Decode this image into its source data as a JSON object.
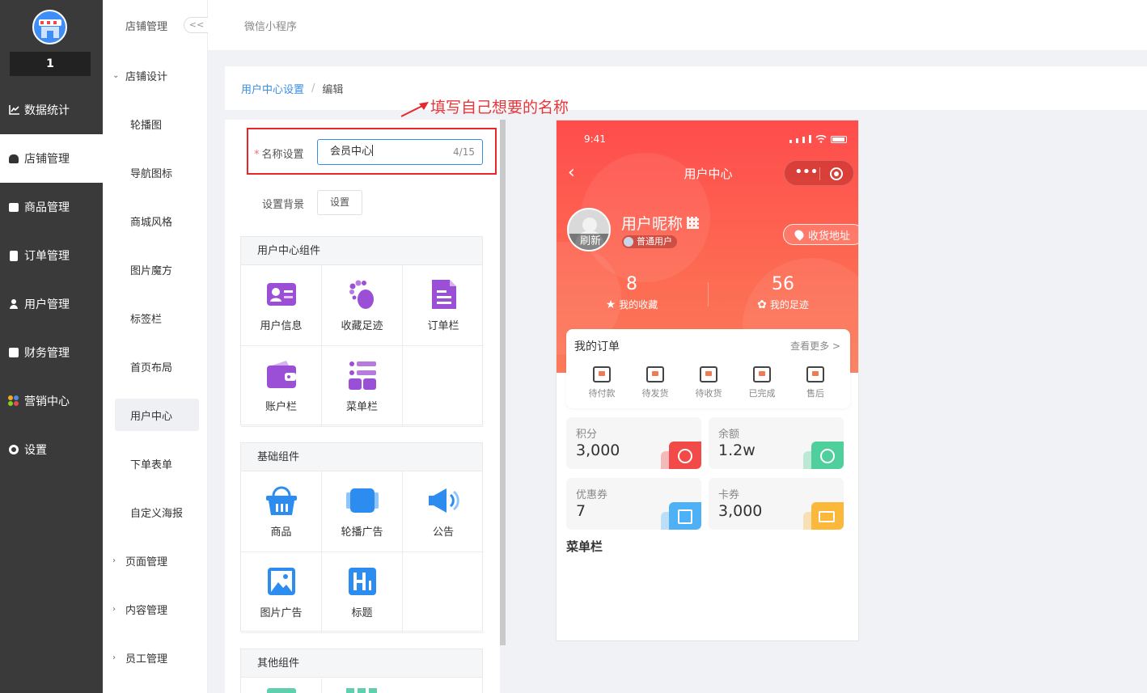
{
  "store": {
    "number": "1"
  },
  "main_nav": [
    {
      "label": "数据统计",
      "icon": "chart-line-icon"
    },
    {
      "label": "店铺管理",
      "icon": "store-icon"
    },
    {
      "label": "商品管理",
      "icon": "goods-icon"
    },
    {
      "label": "订单管理",
      "icon": "order-icon"
    },
    {
      "label": "用户管理",
      "icon": "user-icon"
    },
    {
      "label": "财务管理",
      "icon": "finance-icon"
    },
    {
      "label": "营销中心",
      "icon": "marketing-icon"
    },
    {
      "label": "设置",
      "icon": "settings-icon"
    }
  ],
  "sub_nav": {
    "header": "店铺管理",
    "collapse_label": "<<",
    "group_open": "店铺设计",
    "items": [
      "轮播图",
      "导航图标",
      "商城风格",
      "图片魔方",
      "标签栏",
      "首页布局",
      "用户中心",
      "下单表单",
      "自定义海报"
    ],
    "groups_closed": [
      "页面管理",
      "内容管理",
      "员工管理"
    ]
  },
  "topbar": {
    "tab": "微信小程序"
  },
  "breadcrumb": {
    "link": "用户中心设置",
    "separator": "/",
    "current": "编辑"
  },
  "annotation": {
    "text": "填写自己想要的名称",
    "color": "#e8353a"
  },
  "form": {
    "required_mark": "*",
    "name_label": "名称设置",
    "name_value": "会员中心",
    "name_count": "4/15",
    "bg_label": "设置背景",
    "bg_button": "设置"
  },
  "sections": [
    {
      "title": "用户中心组件",
      "items": [
        {
          "label": "用户信息",
          "icon": "user-card-icon"
        },
        {
          "label": "收藏足迹",
          "icon": "footprint-icon"
        },
        {
          "label": "订单栏",
          "icon": "order-doc-icon"
        },
        {
          "label": "账户栏",
          "icon": "wallet-icon"
        },
        {
          "label": "菜单栏",
          "icon": "menu-grid-icon"
        }
      ]
    },
    {
      "title": "基础组件",
      "items": [
        {
          "label": "商品",
          "icon": "basket-icon"
        },
        {
          "label": "轮播广告",
          "icon": "carousel-icon"
        },
        {
          "label": "公告",
          "icon": "megaphone-icon"
        },
        {
          "label": "图片广告",
          "icon": "image-icon"
        },
        {
          "label": "标题",
          "icon": "heading-icon"
        }
      ]
    },
    {
      "title": "其他组件",
      "items": []
    }
  ],
  "phone": {
    "time": "9:41",
    "title": "用户中心",
    "avatar_refresh": "刷新",
    "nickname": "用户昵称",
    "member_level": "普通用户",
    "address_button": "收货地址",
    "stats": [
      {
        "num": "8",
        "label": "我的收藏",
        "icon": "star-icon"
      },
      {
        "num": "56",
        "label": "我的足迹",
        "icon": "footprint-icon"
      }
    ],
    "orders": {
      "title": "我的订单",
      "more": "查看更多 >",
      "items": [
        {
          "label": "待付款",
          "icon": "wallet-icon"
        },
        {
          "label": "待发货",
          "icon": "package-icon"
        },
        {
          "label": "待收货",
          "icon": "truck-icon"
        },
        {
          "label": "已完成",
          "icon": "clipboard-icon"
        },
        {
          "label": "售后",
          "icon": "return-icon"
        }
      ]
    },
    "assets": [
      {
        "name": "积分",
        "value": "3,000",
        "color": "#f24a48",
        "icon": "medal-icon"
      },
      {
        "name": "余额",
        "value": "1.2w",
        "color": "#4fcf9b",
        "icon": "piggy-bank-icon"
      },
      {
        "name": "优惠券",
        "value": "7",
        "color": "#4fb1f5",
        "icon": "gift-icon"
      },
      {
        "name": "卡券",
        "value": "3,000",
        "color": "#fbb83a",
        "icon": "ticket-icon"
      }
    ],
    "menu_label": "菜单栏"
  }
}
